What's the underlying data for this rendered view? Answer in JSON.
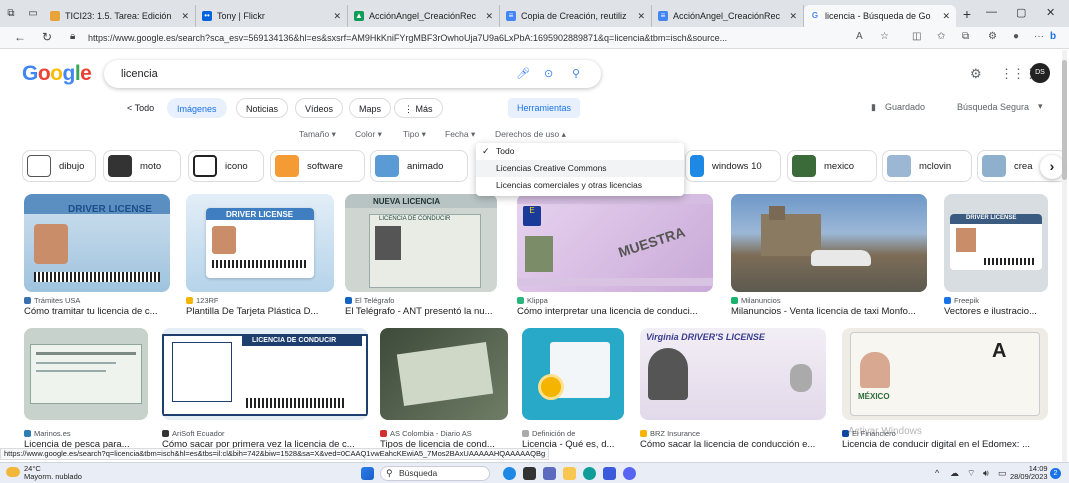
{
  "browser": {
    "tabs": [
      {
        "title": "TICI23: 1.5. Tarea: Edición",
        "color": "#e8a33a"
      },
      {
        "title": "Tony | Flickr",
        "color": "#ff0084"
      },
      {
        "title": "AcciónAngel_CreaciónRec",
        "color": "#0f9d58"
      },
      {
        "title": "Copia de Creación, reutiliz",
        "color": "#4285f4"
      },
      {
        "title": "AcciónAngel_CreaciónRec",
        "color": "#4285f4"
      },
      {
        "title": "licencia - Búsqueda de Go",
        "color": "#4285f4"
      }
    ],
    "url": "https://www.google.es/search?sca_esv=569134136&hl=es&sxsrf=AM9HkKniFYrgMBF3rOwhoUja7U9a6LxPbA:1695902889871&q=licencia&tbm=isch&source..."
  },
  "google": {
    "logo": "Google",
    "query": "licencia",
    "tabs": [
      "< Todo",
      "Imágenes",
      "Noticias",
      "Vídeos",
      "Maps",
      "⋮ Más"
    ],
    "tools_button": "Herramientas",
    "saved": "Guardado",
    "safe_search": "Búsqueda Segura",
    "tools": [
      "Tamaño ▾",
      "Color ▾",
      "Tipo ▾",
      "Fecha ▾",
      "Derechos de uso ▴"
    ],
    "dropdown": [
      "Todo",
      "Licencias Creative Commons",
      "Licencias comerciales y otras licencias"
    ],
    "chips": [
      "dibujo",
      "moto",
      "icono",
      "software",
      "animado",
      "windows 10",
      "mexico",
      "mclovin",
      "crea"
    ]
  },
  "results_row1": [
    {
      "source": "Trámites USA",
      "caption": "Cómo tramitar tu licencia de c...",
      "color": "#9fc3de"
    },
    {
      "source": "123RF",
      "caption": "Plantilla De Tarjeta Plástica D...",
      "color": "#b5d3ea"
    },
    {
      "source": "El Telégrafo",
      "caption": "El Telégrafo - ANT presentó la nu...",
      "color": "#cfd6d2"
    },
    {
      "source": "Klippa",
      "caption": "Cómo interpretar una licencia de conduci...",
      "color": "#c9a9d8"
    },
    {
      "source": "Milanuncios",
      "caption": "Milanuncios - Venta licencia de taxi Monfo...",
      "color": "#5d7fa8"
    },
    {
      "source": "Freepik",
      "caption": "Vectores e ilustracio...",
      "color": "#d8dde2"
    }
  ],
  "results_row2": [
    {
      "source": "Marinos.es",
      "caption": "Licencia de pesca para...",
      "color": "#dbe6e2"
    },
    {
      "source": "AriSoft Ecuador",
      "caption": "Cómo sacar por primera vez la licencia de c...",
      "color": "#e6eef5"
    },
    {
      "source": "AS Colombia - Diario AS",
      "caption": "Tipos de licencia de cond...",
      "color": "#4f5b4c"
    },
    {
      "source": "Definición de",
      "caption": "Licencia - Qué es, d...",
      "color": "#28a9c7"
    },
    {
      "source": "BRZ Insurance",
      "caption": "Cómo sacar la licencia de conducción e...",
      "color": "#e9e2ee"
    },
    {
      "source": "El Financiero",
      "caption": "Licencia de conducir digital en el Edomex: ...",
      "color": "#e8e6e0"
    }
  ],
  "card_texts": {
    "driver_license": "DRIVER LICENSE",
    "nueva_licencia": "NUEVA LICENCIA",
    "licencia_conducir": "LICENCIA DE CONDUCIR",
    "muestra": "MUESTRA",
    "virginia": "Virginia DRIVER'S LICENSE",
    "mexico": "MÉXICO"
  },
  "status_url": "https://www.google.es/search?q=licencia&tbm=isch&hl=es&tbs=il:cl&bih=742&biw=1528&sa=X&ved=0CAAQ1vwEahcKEwiA5_7Mos2BAxUAAAAAHQAAAAAQBg",
  "watermark": "Activar Windows",
  "taskbar": {
    "temp": "24°C",
    "weather": "Mayorm. nublado",
    "search": "Búsqueda",
    "time": "14:09",
    "date": "28/09/2023"
  }
}
